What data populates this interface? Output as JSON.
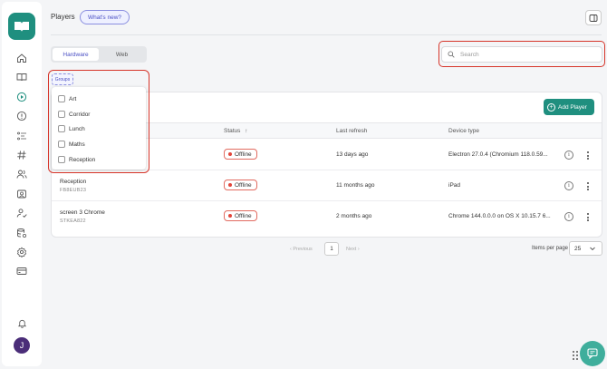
{
  "header": {
    "title": "Players",
    "whats_new": "What's new?"
  },
  "sidebar": {
    "items": [
      {
        "name": "home-icon"
      },
      {
        "name": "book-icon"
      },
      {
        "name": "play-circle-icon"
      },
      {
        "name": "alert-circle-icon"
      },
      {
        "name": "schedule-list-icon"
      },
      {
        "name": "hashtag-icon"
      },
      {
        "name": "users-icon"
      },
      {
        "name": "media-icon"
      },
      {
        "name": "user-check-icon"
      },
      {
        "name": "database-settings-icon"
      },
      {
        "name": "settings-icon"
      },
      {
        "name": "billing-icon"
      }
    ],
    "avatar_initial": "J"
  },
  "tabs": [
    {
      "label": "Hardware",
      "active": true
    },
    {
      "label": "Web",
      "active": false
    }
  ],
  "search": {
    "placeholder": "Search"
  },
  "add_player": "Add Player",
  "groups": {
    "label": "Groups",
    "options": [
      "Art",
      "Corridor",
      "Lunch",
      "Maths",
      "Reception"
    ]
  },
  "table": {
    "columns": [
      "Status",
      "Last refresh",
      "Device type"
    ],
    "rows": [
      {
        "name": "",
        "id": "",
        "status": "Offline",
        "last_refresh": "13 days ago",
        "device": "Electron 27.0.4 (Chromium 118.0.59..."
      },
      {
        "name": "Reception",
        "id": "FB8EUB23",
        "status": "Offline",
        "last_refresh": "11 months ago",
        "device": "iPad"
      },
      {
        "name": "screen 3 Chrome",
        "id": "STKEA822",
        "status": "Offline",
        "last_refresh": "2 months ago",
        "device": "Chrome 144.0.0.0 on OS X 10.15.7 6..."
      }
    ]
  },
  "pagination": {
    "previous": "Previous",
    "next": "Next",
    "page": "1",
    "items_per_page_label": "Items per page",
    "items_per_page": "25"
  },
  "colors": {
    "brand": "#1f8f7f",
    "accent": "#4a4fc4",
    "offline": "#e2453a",
    "highlight": "#d6352a"
  }
}
